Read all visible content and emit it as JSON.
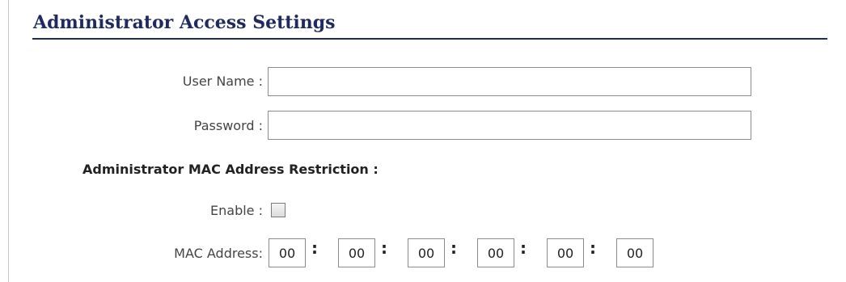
{
  "section": {
    "title": "Administrator Access Settings"
  },
  "fields": {
    "user_name": {
      "label": "User Name :",
      "value": ""
    },
    "password": {
      "label": "Password :",
      "value": ""
    }
  },
  "mac_restriction": {
    "heading": "Administrator MAC Address Restriction :",
    "enable_label": "Enable :",
    "enabled": false,
    "mac_label": "MAC Address:",
    "octets": [
      "00",
      "00",
      "00",
      "00",
      "00",
      "00"
    ],
    "separator": ":"
  },
  "colors": {
    "title": "#1f2a5e",
    "input_border": "#8c8c8c"
  }
}
